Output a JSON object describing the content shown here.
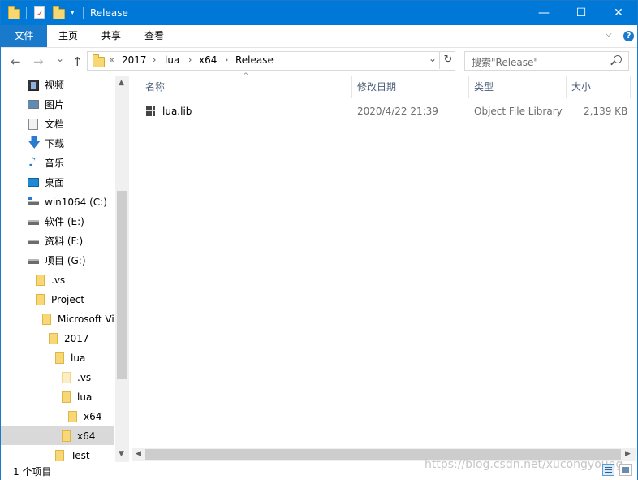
{
  "window": {
    "title": "Release",
    "minimize": "—",
    "maximize": "☐",
    "close": "✕"
  },
  "ribbon": {
    "file_tab": "文件",
    "tabs": [
      "主页",
      "共享",
      "查看"
    ],
    "help": "?",
    "collapse": "⌵"
  },
  "nav": {
    "back": "←",
    "forward": "→",
    "recent": "⌄",
    "up": "↑"
  },
  "address": {
    "overflow": "«",
    "parts": [
      "2017",
      "lua",
      "x64",
      "Release"
    ],
    "sep": "›",
    "dropdown": "⌄",
    "refresh": "↻"
  },
  "search": {
    "placeholder": "搜索\"Release\""
  },
  "sidebar": {
    "items": [
      {
        "label": "视频",
        "icon": "video-icon"
      },
      {
        "label": "图片",
        "icon": "pictures-icon"
      },
      {
        "label": "文档",
        "icon": "documents-icon"
      },
      {
        "label": "下载",
        "icon": "downloads-icon"
      },
      {
        "label": "音乐",
        "icon": "music-icon"
      },
      {
        "label": "桌面",
        "icon": "desktop-icon"
      },
      {
        "label": "win1064 (C:)",
        "icon": "system-drive-icon"
      },
      {
        "label": "软件 (E:)",
        "icon": "drive-icon"
      },
      {
        "label": "资料 (F:)",
        "icon": "drive-icon"
      },
      {
        "label": "项目 (G:)",
        "icon": "drive-icon"
      },
      {
        "label": ".vs",
        "icon": "folder-icon"
      },
      {
        "label": "Project",
        "icon": "folder-icon"
      },
      {
        "label": "Microsoft Vi",
        "icon": "folder-icon"
      },
      {
        "label": "2017",
        "icon": "folder-icon"
      },
      {
        "label": "lua",
        "icon": "folder-icon"
      },
      {
        "label": ".vs",
        "icon": "hidden-folder-icon"
      },
      {
        "label": "lua",
        "icon": "folder-icon"
      },
      {
        "label": "x64",
        "icon": "folder-icon"
      },
      {
        "label": "x64",
        "icon": "folder-icon",
        "selected": true
      },
      {
        "label": "Test",
        "icon": "folder-icon"
      }
    ],
    "scroll_up": "▲",
    "scroll_down": "▼"
  },
  "columns": {
    "name": "名称",
    "modified": "修改日期",
    "type": "类型",
    "size": "大小",
    "sort": "^"
  },
  "files": [
    {
      "name": "lua.lib",
      "modified": "2020/4/22 21:39",
      "type": "Object File Library",
      "size": "2,139 KB"
    }
  ],
  "hscroll": {
    "left": "◀",
    "right": "▶"
  },
  "status": {
    "count": "1 个项目"
  },
  "watermark": "https://blog.csdn.net/xucongyoung",
  "colors": {
    "accent": "#0078d7",
    "file_tab": "#1979ca",
    "selection": "#d9d9d9"
  }
}
